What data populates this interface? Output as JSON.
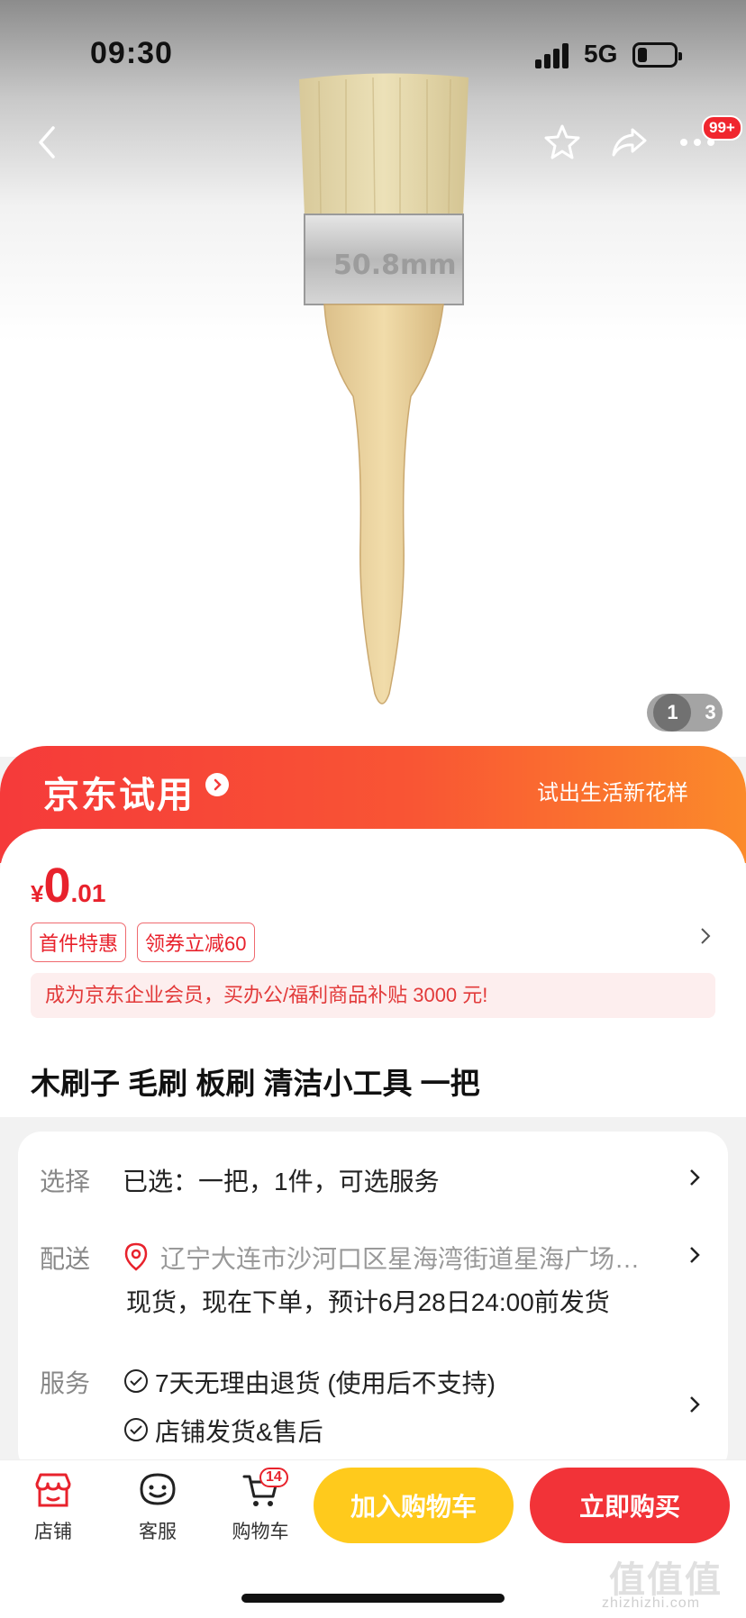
{
  "status_bar": {
    "time": "09:30",
    "network": "5G"
  },
  "nav": {
    "more_badge": "99+"
  },
  "gallery": {
    "current": "1",
    "total": "3"
  },
  "trial_banner": {
    "title": "京东试用",
    "slogan": "试出生活新花样"
  },
  "price": {
    "currency": "¥",
    "integer": "0",
    "decimal": ".01"
  },
  "tags": [
    "首件特惠",
    "领券立减60"
  ],
  "promo_text": "成为京东企业会员，买办公/福利商品补贴 3000 元!",
  "product_title": "木刷子 毛刷 板刷 清洁小工具 一把",
  "options": {
    "select_label": "选择",
    "select_value": "已选：一把，1件，可选服务",
    "delivery_label": "配送",
    "delivery_address": "辽宁大连市沙河口区星海湾街道星海广场…",
    "delivery_eta": "现货，现在下单，预计6月28日24:00前发货",
    "service_label": "服务",
    "services": [
      "7天无理由退货 (使用后不支持)",
      "店铺发货&售后"
    ]
  },
  "bottom_bar": {
    "store_label": "店铺",
    "service_label": "客服",
    "cart_label": "购物车",
    "cart_count": "14",
    "add_to_cart": "加入购物车",
    "buy_now": "立即购买"
  },
  "watermark": {
    "text": "值值值",
    "url": "zhizhizhi.com"
  },
  "colors": {
    "accent": "#e8222c",
    "cart_button": "#ffca1c",
    "buy_button": "#f23338"
  }
}
